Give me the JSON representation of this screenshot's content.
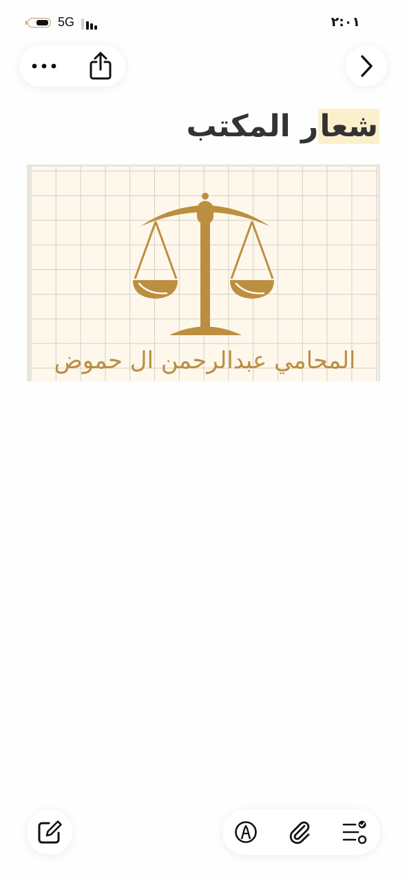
{
  "status_bar": {
    "network": "5G",
    "time": "٢:٠١"
  },
  "toolbar": {
    "more_icon": "ellipsis-icon",
    "share_icon": "share-icon",
    "forward_icon": "chevron-right-icon"
  },
  "note": {
    "title_highlighted": "شعا",
    "title_rest": "ر المكتب"
  },
  "logo": {
    "caption": "المحامي عبدالرحمن ال حموض",
    "gold_color": "#ba8e40",
    "background_color": "#fdf7ec"
  },
  "bottom_bar": {
    "compose_icon": "compose-icon",
    "markup_icon": "markup-pen-icon",
    "attach_icon": "paperclip-icon",
    "checklist_icon": "checklist-icon"
  }
}
